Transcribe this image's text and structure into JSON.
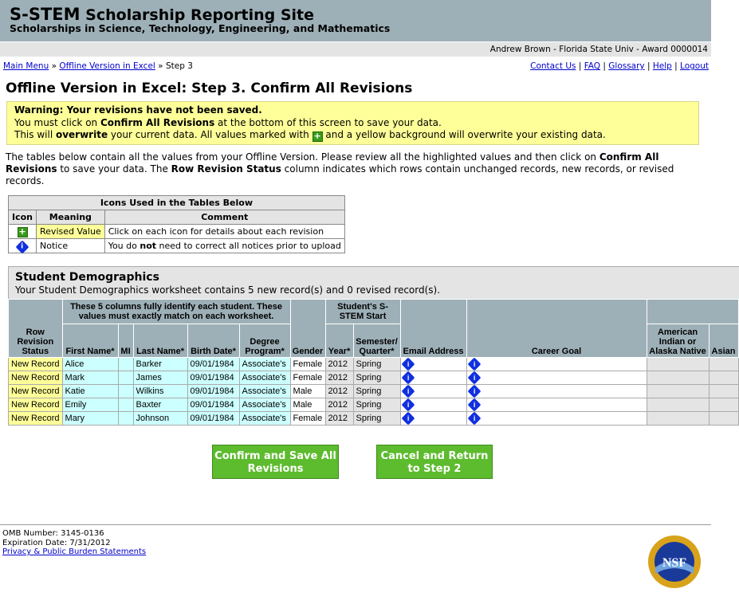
{
  "header": {
    "title_bold": "S-STEM",
    "title_rest": "Scholarship Reporting Site",
    "subtitle": "Scholarships in Science, Technology, Engineering, and Mathematics"
  },
  "user_bar": "Andrew Brown - Florida State Univ - Award 0000014",
  "breadcrumb": {
    "items": [
      "Main Menu",
      "Offline Version in Excel"
    ],
    "current": "Step 3",
    "sep": "»"
  },
  "top_links": [
    "Contact Us",
    "FAQ",
    "Glossary",
    "Help",
    "Logout"
  ],
  "page_title": "Offline Version in Excel: Step 3. Confirm All Revisions",
  "warning": {
    "heading": "Warning: Your revisions have not been saved.",
    "l2a": "You must click on ",
    "l2b": "Confirm All Revisions",
    "l2c": " at the bottom of this screen to save your data.",
    "l3a": "This will ",
    "l3b": "overwrite",
    "l3c": " your current data. All values marked with ",
    "l3d": " and a yellow background will overwrite your existing data."
  },
  "intro": {
    "a": "The tables below contain all the values from your Offline Version. Please review all the highlighted values and then click on ",
    "b": "Confirm All Revisions",
    "c": " to save your data. The ",
    "d": "Row Revision Status",
    "e": " column indicates which rows contain unchanged records, new records, or revised records."
  },
  "legend": {
    "title": "Icons Used in the Tables Below",
    "headers": [
      "Icon",
      "Meaning",
      "Comment"
    ],
    "rows": [
      {
        "icon": "plus-icon",
        "meaning": "Revised Value",
        "comment": "Click on each icon for details about each revision"
      },
      {
        "icon": "info-icon",
        "meaning": "Notice",
        "c1": "You do ",
        "c2": "not",
        "c3": " need to correct all notices prior to upload"
      }
    ]
  },
  "section": {
    "title": "Student Demographics",
    "summary": "Your Student Demographics worksheet contains 5 new record(s) and 0 revised record(s)."
  },
  "table": {
    "group1": "These 5 columns fully identify each student. These values must exactly match on each worksheet.",
    "group2": "Student's S-STEM Start",
    "headers": [
      "Row Revision Status",
      "First Name*",
      "MI",
      "Last Name*",
      "Birth Date*",
      "Degree Program*",
      "Gender",
      "Year*",
      "Semester/ Quarter*",
      "Email Address",
      "Career Goal",
      "American Indian or Alaska Native",
      "Asian"
    ],
    "rows": [
      [
        "New Record",
        "Alice",
        "",
        "Barker",
        "09/01/1984",
        "Associate's",
        "Female",
        "2012",
        "Spring"
      ],
      [
        "New Record",
        "Mark",
        "",
        "James",
        "09/01/1984",
        "Associate's",
        "Female",
        "2012",
        "Spring"
      ],
      [
        "New Record",
        "Katie",
        "",
        "Wilkins",
        "09/01/1984",
        "Associate's",
        "Male",
        "2012",
        "Spring"
      ],
      [
        "New Record",
        "Emily",
        "",
        "Baxter",
        "09/01/1984",
        "Associate's",
        "Male",
        "2012",
        "Spring"
      ],
      [
        "New Record",
        "Mary",
        "",
        "Johnson",
        "09/01/1984",
        "Associate's",
        "Female",
        "2012",
        "Spring"
      ]
    ]
  },
  "buttons": {
    "confirm": "Confirm and Save All Revisions",
    "cancel": "Cancel and Return to Step 2"
  },
  "footer": {
    "omb": "OMB Number: 3145-0136",
    "exp": "Expiration Date: 7/31/2012",
    "privacy": "Privacy & Public Burden Statements",
    "logo": "NSF"
  },
  "colors": {
    "header": "#9eb0b7",
    "revised": "#ffff99",
    "key": "#ccffff",
    "button": "#5dbb2e"
  }
}
